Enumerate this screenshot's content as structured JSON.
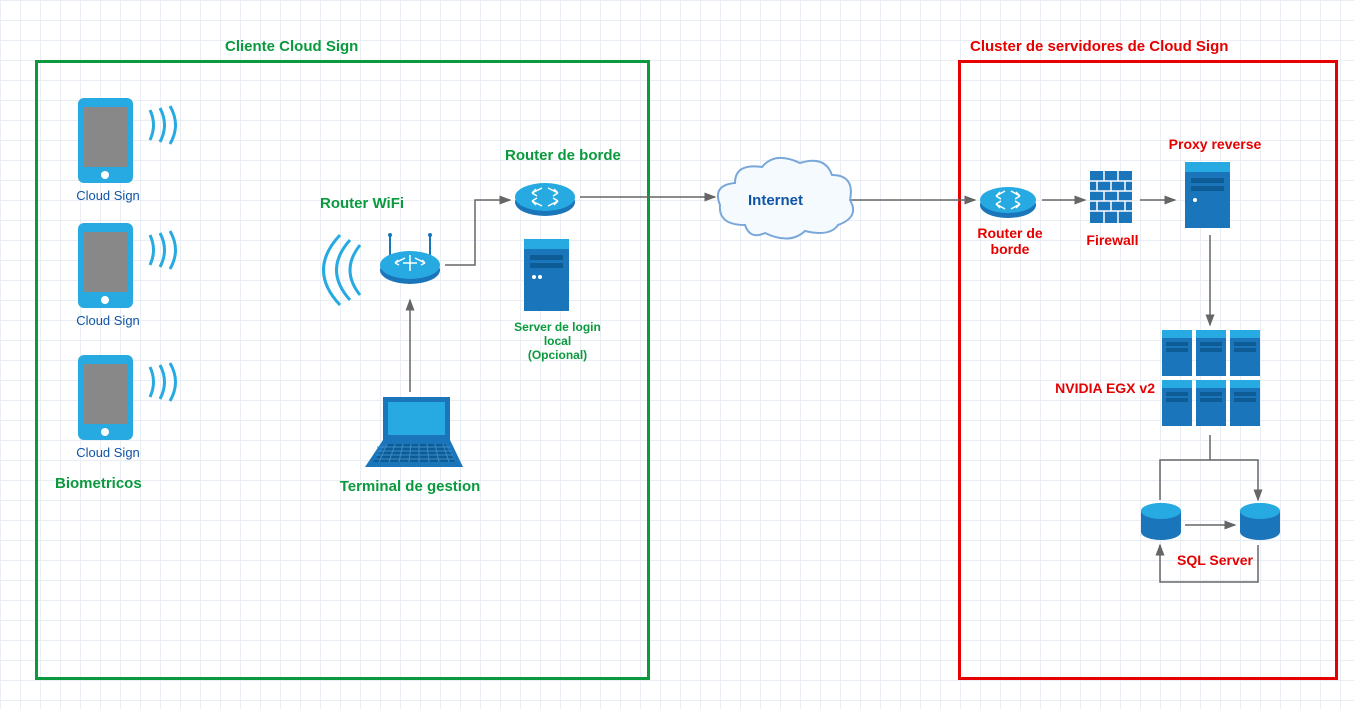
{
  "client": {
    "title": "Cliente Cloud Sign",
    "biometrics_label": "Biometricos",
    "phone_label": "Cloud Sign",
    "wifi_router_label": "Router WiFi",
    "edge_router_label": "Router de borde",
    "local_server_label": "Server de login local\n(Opcional)",
    "terminal_label": "Terminal de gestion"
  },
  "internet_label": "Internet",
  "cluster": {
    "title": "Cluster de servidores de Cloud Sign",
    "edge_router_label": "Router de borde",
    "firewall_label": "Firewall",
    "proxy_label": "Proxy reverse",
    "gpu_label": "NVIDIA EGX v2",
    "db_label": "SQL Server"
  }
}
